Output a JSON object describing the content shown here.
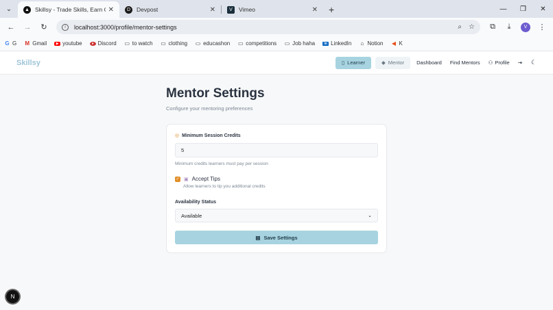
{
  "browser": {
    "tabs": [
      {
        "title": "Skillsy - Trade Skills, Earn Credit",
        "favicon": "skillsy-favicon",
        "active": true
      },
      {
        "title": "Devpost",
        "favicon": "devpost-favicon",
        "active": false
      },
      {
        "title": "Vimeo",
        "favicon": "vimeo-favicon",
        "active": false
      }
    ],
    "url": "localhost:3000/profile/mentor-settings",
    "profile_initial": "V",
    "bookmarks": [
      {
        "label": "G",
        "icon": "google-icon"
      },
      {
        "label": "Gmail",
        "icon": "gmail-icon"
      },
      {
        "label": "youtube",
        "icon": "youtube-icon"
      },
      {
        "label": "Discord",
        "icon": "discord-icon"
      },
      {
        "label": "to watch",
        "icon": "folder-icon"
      },
      {
        "label": "clothing",
        "icon": "folder-icon"
      },
      {
        "label": "educashon",
        "icon": "folder-icon"
      },
      {
        "label": "competitions",
        "icon": "folder-icon"
      },
      {
        "label": "Job haha",
        "icon": "folder-icon"
      },
      {
        "label": "LinkedIn",
        "icon": "linkedin-icon"
      },
      {
        "label": "Notion",
        "icon": "notion-icon"
      },
      {
        "label": "K",
        "icon": "k-icon"
      }
    ]
  },
  "app": {
    "logo": "Skillsy",
    "nav": {
      "learner": "Learner",
      "mentor": "Mentor",
      "dashboard": "Dashboard",
      "find_mentors": "Find Mentors",
      "profile": "Profile"
    }
  },
  "page": {
    "title": "Mentor Settings",
    "subtitle": "Configure your mentoring preferences",
    "min_credits": {
      "label": "Minimum Session Credits",
      "value": "5",
      "help": "Minimum credits learners must pay per session"
    },
    "tips": {
      "label": "Accept Tips",
      "checked": true,
      "help": "Allow learners to tip you additional credits"
    },
    "availability": {
      "label": "Availability Status",
      "value": "Available"
    },
    "save_label": "Save Settings"
  },
  "badge": "N",
  "colors": {
    "accent": "#a7d3e0",
    "checkbox": "#e08f2a",
    "logo": "#9ec4d8"
  }
}
